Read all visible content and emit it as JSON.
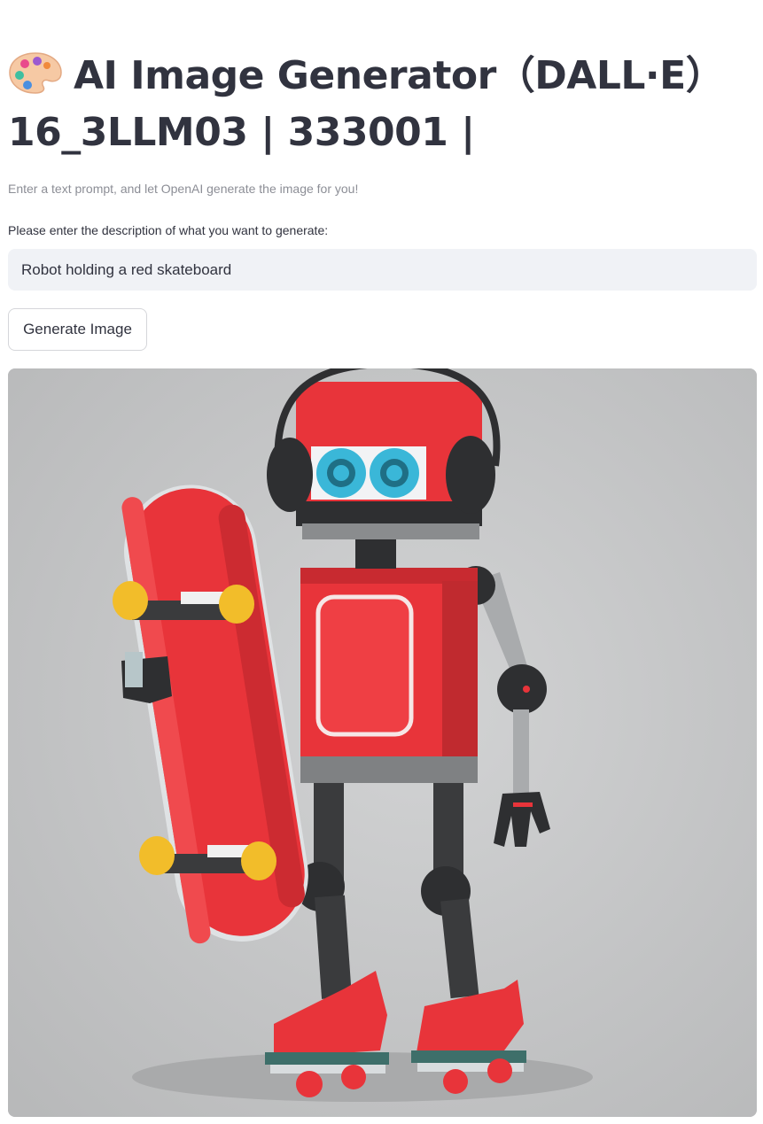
{
  "header": {
    "title_line1": "AI Image Generator（DALL·E）",
    "title_line2": "16_3LLM03 | 333001 |",
    "icon": "artist-palette-icon"
  },
  "caption": "Enter a text prompt, and let OpenAI generate the image for you!",
  "prompt": {
    "label": "Please enter the description of what you want to generate:",
    "value": "Robot holding a red skateboard"
  },
  "generate_button": {
    "label": "Generate Image"
  },
  "generated_image": {
    "subject": "robot-holding-red-skateboard",
    "colors": {
      "background": "#c4c5c6",
      "robot_red": "#e8343a",
      "dark": "#3a3b3d",
      "eye_blue": "#3ab7d8",
      "wheel_yellow": "#f2bd2a"
    }
  },
  "theme": {
    "text": "#31333f",
    "caption": "#8c8e96",
    "input_bg": "#f0f2f6"
  }
}
